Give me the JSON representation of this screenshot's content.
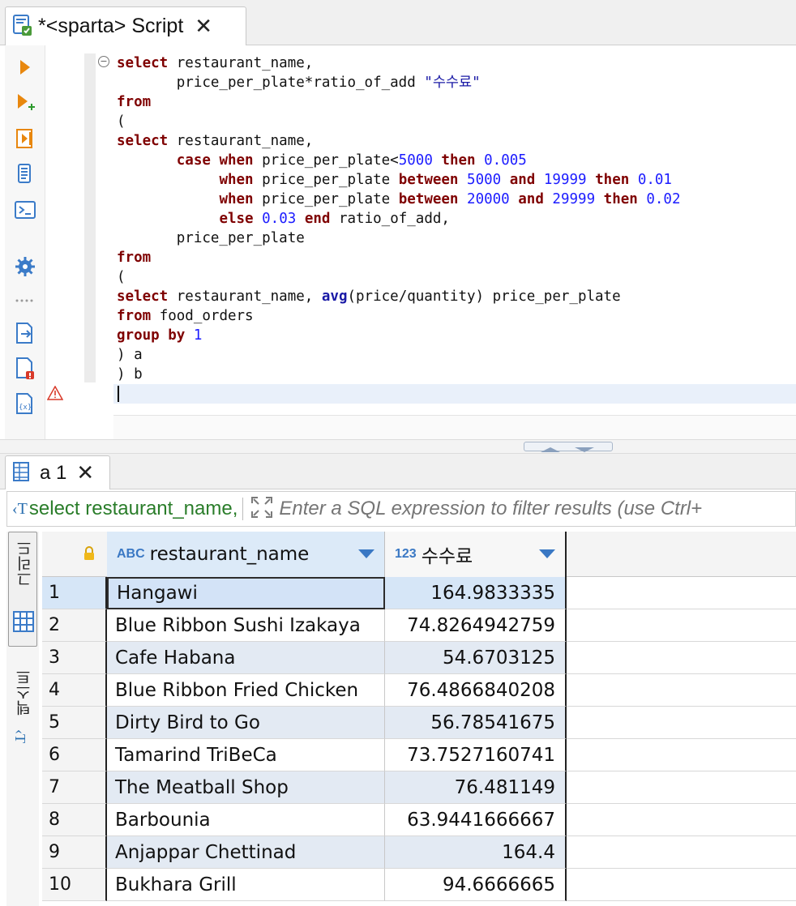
{
  "editor_tab": {
    "title": "*<sparta> Script",
    "close": "✕"
  },
  "code_lines": [
    [
      {
        "t": "select",
        "c": "kw"
      },
      {
        "t": " restaurant_name,",
        "c": ""
      }
    ],
    [
      {
        "t": "       price_per_plate*ratio_of_add ",
        "c": ""
      },
      {
        "t": "\"수수료\"",
        "c": "str"
      }
    ],
    [
      {
        "t": "from",
        "c": "kw"
      }
    ],
    [
      {
        "t": "(",
        "c": ""
      }
    ],
    [
      {
        "t": "select",
        "c": "kw"
      },
      {
        "t": " restaurant_name,",
        "c": ""
      }
    ],
    [
      {
        "t": "       ",
        "c": ""
      },
      {
        "t": "case when",
        "c": "kw"
      },
      {
        "t": " price_per_plate<",
        "c": ""
      },
      {
        "t": "5000",
        "c": "num"
      },
      {
        "t": " ",
        "c": ""
      },
      {
        "t": "then",
        "c": "kw"
      },
      {
        "t": " ",
        "c": ""
      },
      {
        "t": "0.005",
        "c": "num"
      }
    ],
    [
      {
        "t": "            ",
        "c": ""
      },
      {
        "t": "when",
        "c": "kw"
      },
      {
        "t": " price_per_plate ",
        "c": ""
      },
      {
        "t": "between",
        "c": "kw"
      },
      {
        "t": " ",
        "c": ""
      },
      {
        "t": "5000",
        "c": "num"
      },
      {
        "t": " ",
        "c": ""
      },
      {
        "t": "and",
        "c": "kw"
      },
      {
        "t": " ",
        "c": ""
      },
      {
        "t": "19999",
        "c": "num"
      },
      {
        "t": " ",
        "c": ""
      },
      {
        "t": "then",
        "c": "kw"
      },
      {
        "t": " ",
        "c": ""
      },
      {
        "t": "0.01",
        "c": "num"
      }
    ],
    [
      {
        "t": "            ",
        "c": ""
      },
      {
        "t": "when",
        "c": "kw"
      },
      {
        "t": " price_per_plate ",
        "c": ""
      },
      {
        "t": "between",
        "c": "kw"
      },
      {
        "t": " ",
        "c": ""
      },
      {
        "t": "20000",
        "c": "num"
      },
      {
        "t": " ",
        "c": ""
      },
      {
        "t": "and",
        "c": "kw"
      },
      {
        "t": " ",
        "c": ""
      },
      {
        "t": "29999",
        "c": "num"
      },
      {
        "t": " ",
        "c": ""
      },
      {
        "t": "then",
        "c": "kw"
      },
      {
        "t": " ",
        "c": ""
      },
      {
        "t": "0.02",
        "c": "num"
      }
    ],
    [
      {
        "t": "            ",
        "c": ""
      },
      {
        "t": "else",
        "c": "kw"
      },
      {
        "t": " ",
        "c": ""
      },
      {
        "t": "0.03",
        "c": "num"
      },
      {
        "t": " ",
        "c": ""
      },
      {
        "t": "end",
        "c": "kw"
      },
      {
        "t": " ratio_of_add,",
        "c": ""
      }
    ],
    [
      {
        "t": "       price_per_plate",
        "c": ""
      }
    ],
    [
      {
        "t": "from",
        "c": "kw"
      }
    ],
    [
      {
        "t": "(",
        "c": ""
      }
    ],
    [
      {
        "t": "select",
        "c": "kw"
      },
      {
        "t": " restaurant_name, ",
        "c": ""
      },
      {
        "t": "avg",
        "c": "fn"
      },
      {
        "t": "(price/quantity) price_per_plate",
        "c": ""
      }
    ],
    [
      {
        "t": "from",
        "c": "kw"
      },
      {
        "t": " food_orders",
        "c": ""
      }
    ],
    [
      {
        "t": "group by",
        "c": "kw"
      },
      {
        "t": " ",
        "c": ""
      },
      {
        "t": "1",
        "c": "num"
      }
    ],
    [
      {
        "t": ") a",
        "c": ""
      }
    ],
    [
      {
        "t": ") b",
        "c": ""
      }
    ]
  ],
  "results_tab": {
    "title": "a 1",
    "close": "✕"
  },
  "filter": {
    "query_label": "select restaurant_name,",
    "placeholder": "Enter a SQL expression to filter results (use Ctrl+"
  },
  "side_tabs": {
    "grid": "그리드",
    "text": "텍스트"
  },
  "columns": [
    {
      "type_badge": "ABC",
      "label": "restaurant_name"
    },
    {
      "type_badge": "123",
      "label": "수수료"
    }
  ],
  "rows": [
    {
      "num": "1",
      "name": "Hangawi",
      "fee": "164.9833335"
    },
    {
      "num": "2",
      "name": "Blue Ribbon Sushi Izakaya",
      "fee": "74.8264942759"
    },
    {
      "num": "3",
      "name": "Cafe Habana",
      "fee": "54.6703125"
    },
    {
      "num": "4",
      "name": "Blue Ribbon Fried Chicken",
      "fee": "76.4866840208"
    },
    {
      "num": "5",
      "name": "Dirty Bird to Go",
      "fee": "56.78541675"
    },
    {
      "num": "6",
      "name": "Tamarind TriBeCa",
      "fee": "73.7527160741"
    },
    {
      "num": "7",
      "name": "The Meatball Shop",
      "fee": "76.481149"
    },
    {
      "num": "8",
      "name": "Barbounia",
      "fee": "63.9441666667"
    },
    {
      "num": "9",
      "name": "Anjappar Chettinad",
      "fee": "164.4"
    },
    {
      "num": "10",
      "name": "Bukhara Grill",
      "fee": "94.6666665"
    }
  ],
  "colors": {
    "keyword": "#7f0000",
    "number": "#1c1cff",
    "accent": "#3a78c4",
    "filter_label": "#2a7d2a"
  }
}
